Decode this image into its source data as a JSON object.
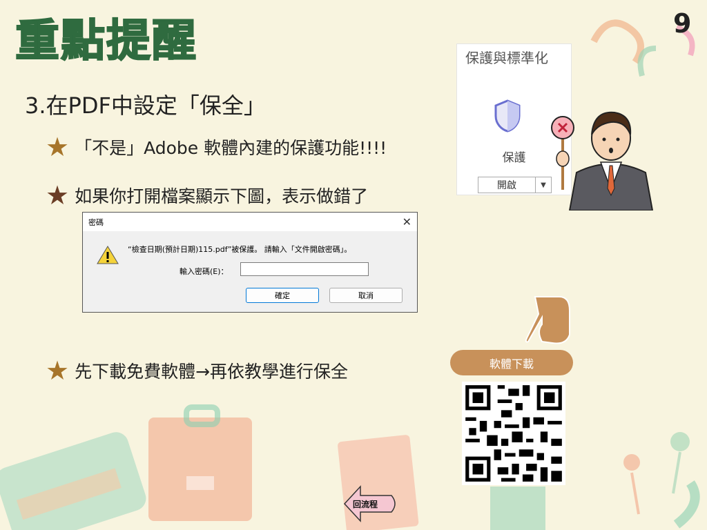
{
  "page_title": "重點提醒",
  "page_number": "9",
  "section_title": "3.在PDF中設定「保全」",
  "bullets": [
    "「不是」Adobe 軟體內建的保護功能!!!!",
    "如果你打開檔案顯示下圖，表示做錯了",
    "先下載免費軟體→再依教學進行保全"
  ],
  "dialog": {
    "title": "密碼",
    "close": "✕",
    "message": "“檢查日期(預計日期)115.pdf”被保護。 請輸入「文件開啟密碼」。",
    "field_label": "輸入密碼(E)：",
    "ok_label": "確定",
    "cancel_label": "取消"
  },
  "protect_panel": {
    "header": "保護與標準化",
    "label": "保護",
    "open_label": "開啟",
    "dropdown": "▼"
  },
  "download_label": "軟體下載",
  "back_label": "回流程",
  "colors": {
    "title": "#2f6b3f",
    "star": "#a7752a",
    "star_dark": "#6b3d25",
    "pill": "#c8915a"
  }
}
